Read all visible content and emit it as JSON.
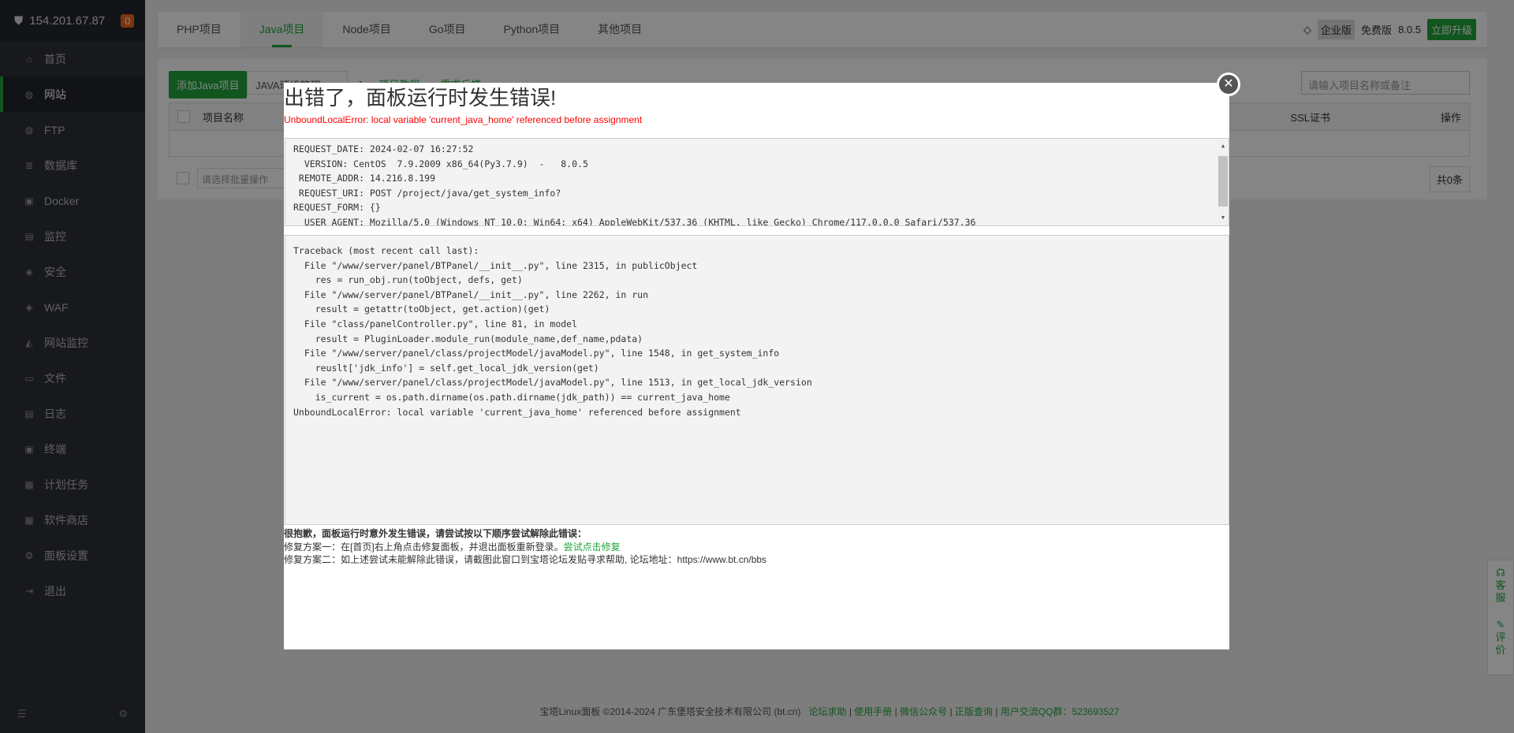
{
  "sidebar": {
    "ip": "154.201.67.87",
    "badge": "0",
    "items": [
      {
        "label": "首页",
        "icon": "home-icon"
      },
      {
        "label": "网站",
        "icon": "globe-icon",
        "active": true
      },
      {
        "label": "FTP",
        "icon": "ftp-icon"
      },
      {
        "label": "数据库",
        "icon": "database-icon"
      },
      {
        "label": "Docker",
        "icon": "docker-icon"
      },
      {
        "label": "监控",
        "icon": "monitor-icon"
      },
      {
        "label": "安全",
        "icon": "shield-icon"
      },
      {
        "label": "WAF",
        "icon": "waf-icon"
      },
      {
        "label": "网站监控",
        "icon": "chart-icon"
      },
      {
        "label": "文件",
        "icon": "folder-icon"
      },
      {
        "label": "日志",
        "icon": "log-icon"
      },
      {
        "label": "终端",
        "icon": "terminal-icon"
      },
      {
        "label": "计划任务",
        "icon": "calendar-icon"
      },
      {
        "label": "软件商店",
        "icon": "store-icon"
      },
      {
        "label": "面板设置",
        "icon": "gear-icon"
      },
      {
        "label": "退出",
        "icon": "logout-icon"
      }
    ]
  },
  "tabs": [
    "PHP项目",
    "Java项目",
    "Node项目",
    "Go项目",
    "Python项目",
    "其他项目"
  ],
  "version": {
    "enterprise": "企业版",
    "free": "免费版",
    "number": "8.0.5",
    "upgrade": "立即升级"
  },
  "toolbar": {
    "add": "添加Java项目",
    "env": "JAVA环境管理",
    "tutorial": "Java项目教程",
    "feedback": "需求反馈",
    "search_placeholder": "请输入项目名称或备注"
  },
  "table": {
    "col_name": "项目名称",
    "col_ssl": "SSL证书",
    "col_op": "操作",
    "batch_placeholder": "请选择批量操作",
    "total": "共0条"
  },
  "modal": {
    "title": "出错了，面板运行时发生错误!",
    "error": "UnboundLocalError: local variable 'current_java_home' referenced before assignment",
    "info": [
      "REQUEST_DATE: 2024-02-07 16:27:52",
      "  VERSION: CentOS  7.9.2009 x86_64(Py3.7.9)  -   8.0.5",
      " REMOTE_ADDR: 14.216.8.199",
      " REQUEST_URI: POST /project/java/get_system_info?",
      "REQUEST_FORM: {}",
      "  USER_AGENT: Mozilla/5.0 (Windows NT 10.0; Win64; x64) AppleWebKit/537.36 (KHTML, like Gecko) Chrome/117.0.0.0 Safari/537.36"
    ],
    "traceback": [
      "Traceback (most recent call last):",
      "  File \"/www/server/panel/BTPanel/__init__.py\", line 2315, in publicObject",
      "    res = run_obj.run(toObject, defs, get)",
      "  File \"/www/server/panel/BTPanel/__init__.py\", line 2262, in run",
      "    result = getattr(toObject, get.action)(get)",
      "  File \"class/panelController.py\", line 81, in model",
      "    result = PluginLoader.module_run(module_name,def_name,pdata)",
      "  File \"/www/server/panel/class/projectModel/javaModel.py\", line 1548, in get_system_info",
      "    reuslt['jdk_info'] = self.get_local_jdk_version(get)",
      "  File \"/www/server/panel/class/projectModel/javaModel.py\", line 1513, in get_local_jdk_version",
      "    is_current = os.path.dirname(os.path.dirname(jdk_path)) == current_java_home",
      "UnboundLocalError: local variable 'current_java_home' referenced before assignment"
    ],
    "help_title": "很抱歉，面板运行时意外发生错误，请尝试按以下顺序尝试解除此错误：",
    "fix1": "修复方案一：在[首页]右上角点击修复面板，并退出面板重新登录。",
    "fix1_link": "尝试点击修复",
    "fix2": "修复方案二：如上述尝试未能解除此错误，请截图此窗口到宝塔论坛发贴寻求帮助, 论坛地址：https://www.bt.cn/bbs"
  },
  "footer": {
    "copyright": "宝塔Linux面板 ©2014-2024 广东堡塔安全技术有限公司 (bt.cn)",
    "links": [
      "论坛求助",
      "使用手册",
      "微信公众号",
      "正版查询",
      "用户交流QQ群：523693527"
    ]
  },
  "widget": {
    "service": "客服",
    "review": "评价"
  },
  "colors": {
    "accent": "#20a53a",
    "error": "#ff0000",
    "sidebar": "#2c3138"
  }
}
